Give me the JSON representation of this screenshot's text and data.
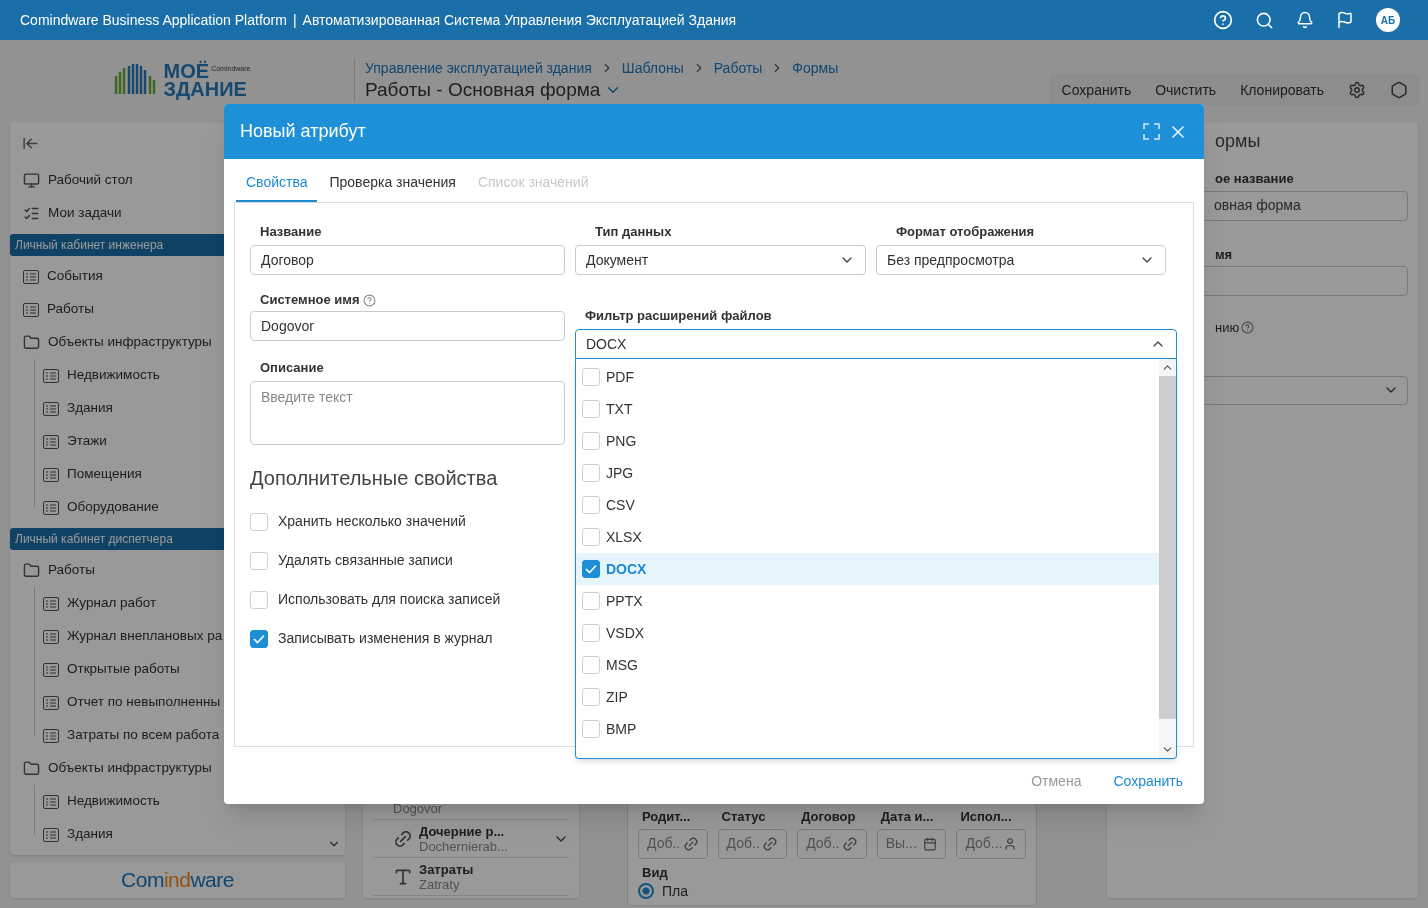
{
  "header": {
    "platform": "Comindware Business Application Platform",
    "separator": "|",
    "app": "Автоматизированная Система Управления Эксплуатацией Здания",
    "avatar": "АБ"
  },
  "logo": {
    "line1": "МОЁ",
    "line2": "ЗДАНИЕ",
    "brand": "Comindware"
  },
  "breadcrumbs": [
    {
      "label": "Управление эксплуатацией здания"
    },
    {
      "label": "Шаблоны"
    },
    {
      "label": "Работы"
    },
    {
      "label": "Формы"
    }
  ],
  "page_title": "Работы - Основная форма",
  "toolbar": [
    "Сохранить",
    "Очистить",
    "Клонировать"
  ],
  "sidebar": [
    {
      "kind": "desktop",
      "label": "Рабочий стол"
    },
    {
      "kind": "tasks",
      "label": "Мои задачи"
    },
    {
      "kind": "section",
      "label": "Личный кабинет инженера"
    },
    {
      "kind": "list",
      "label": "События"
    },
    {
      "kind": "list",
      "label": "Работы"
    },
    {
      "kind": "folder",
      "label": "Объекты инфраструктуры",
      "children": [
        {
          "kind": "list",
          "label": "Недвижимость"
        },
        {
          "kind": "list",
          "label": "Здания"
        },
        {
          "kind": "list",
          "label": "Этажи"
        },
        {
          "kind": "list",
          "label": "Помещения"
        },
        {
          "kind": "list",
          "label": "Оборудование"
        }
      ]
    },
    {
      "kind": "section",
      "label": "Личный кабинет диспетчера"
    },
    {
      "kind": "folder",
      "label": "Работы",
      "children": [
        {
          "kind": "list",
          "label": "Журнал работ"
        },
        {
          "kind": "list",
          "label": "Журнал внеплановых ра"
        },
        {
          "kind": "list",
          "label": "Открытые работы"
        },
        {
          "kind": "list",
          "label": "Отчет по невыполненны"
        },
        {
          "kind": "list",
          "label": "Затраты по всем работа"
        }
      ]
    },
    {
      "kind": "folder",
      "label": "Объекты инфраструктуры",
      "children": [
        {
          "kind": "list",
          "label": "Недвижимость"
        },
        {
          "kind": "list",
          "label": "Здания"
        }
      ]
    }
  ],
  "footer_logo": [
    "Com",
    "ind",
    "ware"
  ],
  "attribute_list": [
    {
      "subtitle": "Dogovor"
    },
    {
      "kind": "link",
      "title": "Дочерние р...",
      "subtitle": "Dochernierab..."
    },
    {
      "kind": "text",
      "title": "Затраты",
      "subtitle": "Zatraty"
    }
  ],
  "form_preview": {
    "columns": [
      {
        "label": "Родит...",
        "placeholder": "Доб..",
        "kind": "link"
      },
      {
        "label": "Статус",
        "placeholder": "Доб..",
        "kind": "link"
      },
      {
        "label": "Договор",
        "placeholder": "Доб..",
        "kind": "link"
      },
      {
        "label": "Дата и...",
        "placeholder": "Вы...",
        "kind": "date"
      },
      {
        "label": "Испол...",
        "placeholder": "Доб...",
        "kind": "user"
      }
    ],
    "view_label": "Вид",
    "radio": {
      "label": "Пла",
      "selected": true
    }
  },
  "properties_panel": {
    "title": "ормы",
    "name_label": "ое название",
    "name_value": "овная форма",
    "sys_label": "мя",
    "hint_label": "нию"
  },
  "modal": {
    "title": "Новый атрибут",
    "tabs": [
      {
        "label": "Свойства",
        "selected": true,
        "disabled": false
      },
      {
        "label": "Проверка значения",
        "selected": false,
        "disabled": false
      },
      {
        "label": "Список значений",
        "selected": false,
        "disabled": true
      }
    ],
    "name": {
      "label": "Название",
      "value": "Договор"
    },
    "data_type": {
      "label": "Тип данных",
      "value": "Документ"
    },
    "display_format": {
      "label": "Формат отображения",
      "value": "Без предпросмотра"
    },
    "system_name": {
      "label": "Системное имя",
      "value": "Dogovor"
    },
    "description": {
      "label": "Описание",
      "placeholder": "Введите текст"
    },
    "file_filter": {
      "label": "Фильтр расширений файлов",
      "value": "DOCX",
      "options": [
        {
          "label": "PDF",
          "checked": false,
          "selected": false
        },
        {
          "label": "TXT",
          "checked": false,
          "selected": false
        },
        {
          "label": "PNG",
          "checked": false,
          "selected": false
        },
        {
          "label": "JPG",
          "checked": false,
          "selected": false
        },
        {
          "label": "CSV",
          "checked": false,
          "selected": false
        },
        {
          "label": "XLSX",
          "checked": false,
          "selected": false
        },
        {
          "label": "DOCX",
          "checked": true,
          "selected": true
        },
        {
          "label": "PPTX",
          "checked": false,
          "selected": false
        },
        {
          "label": "VSDX",
          "checked": false,
          "selected": false
        },
        {
          "label": "MSG",
          "checked": false,
          "selected": false
        },
        {
          "label": "ZIP",
          "checked": false,
          "selected": false
        },
        {
          "label": "BMP",
          "checked": false,
          "selected": false
        }
      ]
    },
    "extra_title": "Дополнительные свойства",
    "extra_options": [
      {
        "label": "Хранить несколько значений",
        "checked": false
      },
      {
        "label": "Удалять связанные записи",
        "checked": false
      },
      {
        "label": "Использовать для поиска записей",
        "checked": false
      },
      {
        "label": "Записывать изменения в журнал",
        "checked": true
      }
    ],
    "cancel": "Отмена",
    "save": "Сохранить"
  }
}
